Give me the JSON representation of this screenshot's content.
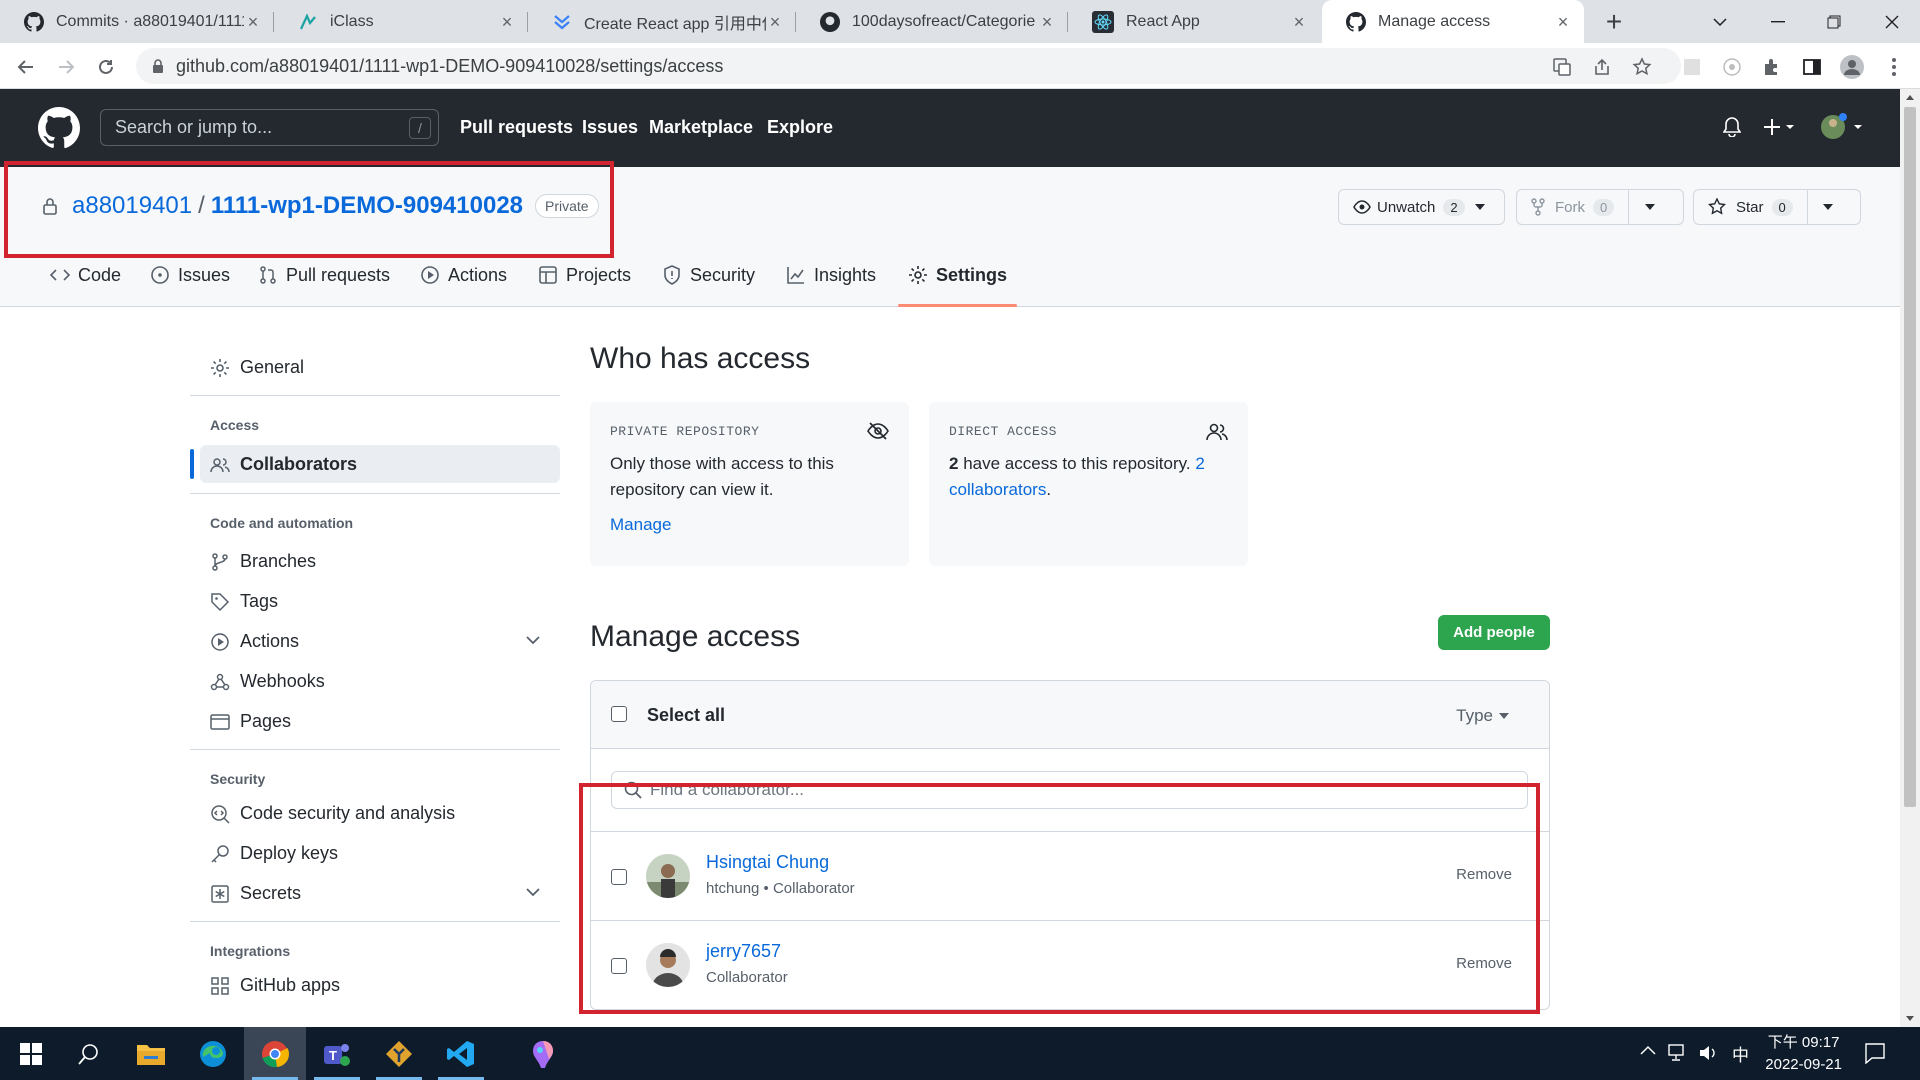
{
  "browser": {
    "tabs": [
      {
        "title": "Commits · a88019401/1111",
        "icon": "github-icon"
      },
      {
        "title": "iClass",
        "icon": "iclass-icon"
      },
      {
        "title": "Create React app 引用中使",
        "icon": "react-create-icon"
      },
      {
        "title": "100daysofreact/Categorie",
        "icon": "github-icon"
      },
      {
        "title": "React App",
        "icon": "react-icon"
      },
      {
        "title": "Manage access",
        "icon": "github-icon",
        "active": true
      }
    ],
    "url": "github.com/a88019401/1111-wp1-DEMO-909410028/settings/access"
  },
  "gh_header": {
    "search_placeholder": "Search or jump to...",
    "search_shortcut": "/",
    "nav": [
      "Pull requests",
      "Issues",
      "Marketplace",
      "Explore"
    ]
  },
  "repo": {
    "owner": "a88019401",
    "separator": "/",
    "name": "1111-wp1-DEMO-909410028",
    "visibility": "Private",
    "unwatch": {
      "label": "Unwatch",
      "count": "2"
    },
    "fork": {
      "label": "Fork",
      "count": "0"
    },
    "star": {
      "label": "Star",
      "count": "0"
    },
    "tabs": [
      "Code",
      "Issues",
      "Pull requests",
      "Actions",
      "Projects",
      "Security",
      "Insights",
      "Settings"
    ],
    "selected_tab": "Settings"
  },
  "sidebar": {
    "general": "General",
    "access_heading": "Access",
    "collaborators": "Collaborators",
    "code_heading": "Code and automation",
    "branches": "Branches",
    "tags": "Tags",
    "actions": "Actions",
    "webhooks": "Webhooks",
    "pages": "Pages",
    "security_heading": "Security",
    "code_security": "Code security and analysis",
    "deploy_keys": "Deploy keys",
    "secrets": "Secrets",
    "integrations_heading": "Integrations",
    "github_apps": "GitHub apps"
  },
  "who_has_access": {
    "title": "Who has access",
    "private_card": {
      "label": "PRIVATE REPOSITORY",
      "text": "Only those with access to this repository can view it.",
      "link": "Manage"
    },
    "direct_card": {
      "label": "DIRECT ACCESS",
      "count": "2",
      "text": " have access to this repository. ",
      "link": "2 collaborators",
      "end": "."
    }
  },
  "manage_access": {
    "title": "Manage access",
    "add_button": "Add people",
    "select_all": "Select all",
    "type_filter": "Type",
    "filter_placeholder": "Find a collaborator...",
    "collaborators": [
      {
        "name": "Hsingtai Chung",
        "sub": "htchung • Collaborator",
        "remove": "Remove"
      },
      {
        "name": "jerry7657",
        "sub": "Collaborator",
        "remove": "Remove"
      }
    ]
  },
  "taskbar": {
    "time": "下午 09:17",
    "date": "2022-09-21",
    "ime": "中"
  },
  "colors": {
    "accent": "#0969da",
    "green": "#2da44e",
    "highlight": "#d1242f",
    "header": "#24292f"
  }
}
